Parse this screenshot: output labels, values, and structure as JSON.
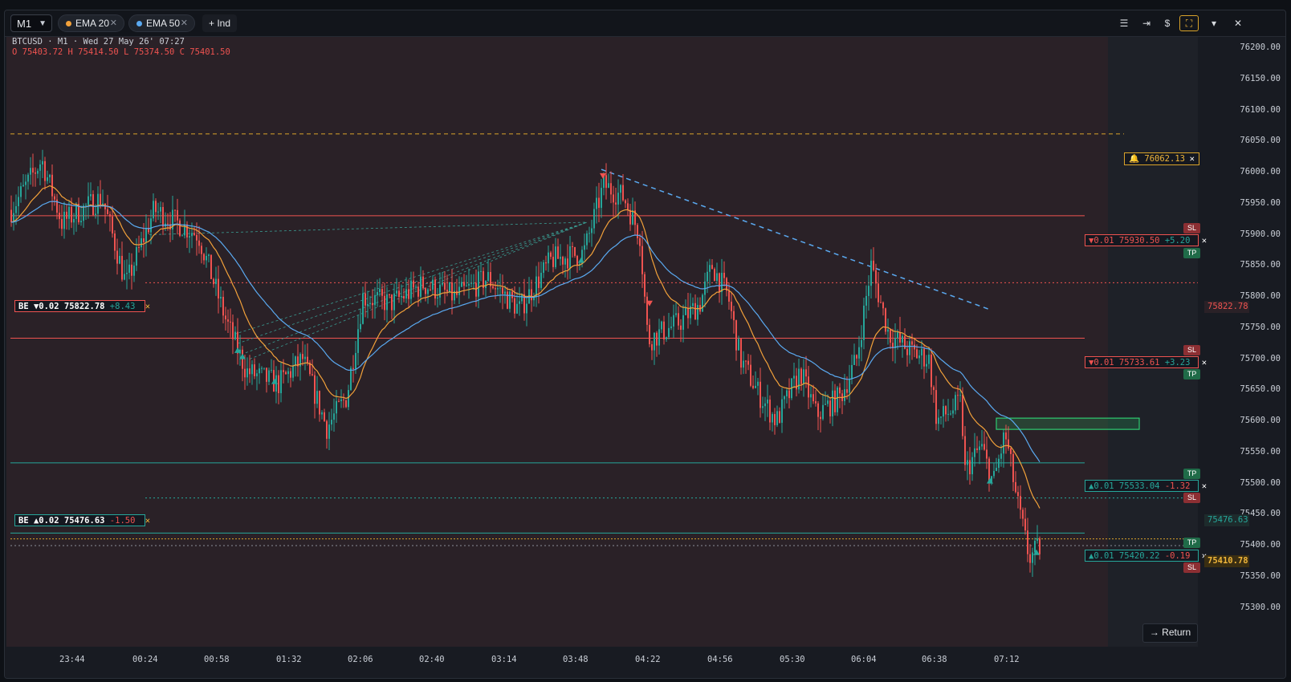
{
  "toolbar": {
    "timeframe": "M1",
    "indicators": [
      {
        "label": "EMA 20",
        "color": "#f2a13a"
      },
      {
        "label": "EMA 50",
        "color": "#5aa9f0"
      }
    ],
    "add_indicator_label": "+ Ind",
    "right_buttons": [
      "☰",
      "⇥",
      "$",
      "⛶",
      "▾",
      "✕"
    ]
  },
  "ohlc": {
    "header": "BTCUSD · M1 · Wed 27 May 26' 07:27",
    "values": "O 75403.72  H 75414.50  L 75374.50  C 75401.50"
  },
  "price_axis": [
    "76200.00",
    "76150.00",
    "76100.00",
    "76050.00",
    "76000.00",
    "75950.00",
    "75900.00",
    "75850.00",
    "75800.00",
    "75750.00",
    "75700.00",
    "75650.00",
    "75600.00",
    "75550.00",
    "75500.00",
    "75450.00",
    "75400.00",
    "75350.00",
    "75300.00"
  ],
  "time_axis": [
    "23:44",
    "00:24",
    "00:58",
    "01:32",
    "02:06",
    "02:40",
    "03:14",
    "03:48",
    "04:22",
    "04:56",
    "05:30",
    "06:04",
    "06:38",
    "07:12"
  ],
  "alert": {
    "label": "🔔 76062.13",
    "close": "✕"
  },
  "positions": [
    {
      "text": "▼0.01 75930.50",
      "pnl": "+5.20",
      "close": "✕",
      "side": "sell"
    },
    {
      "text": "▼0.01 75733.61",
      "pnl": "+3.23",
      "close": "✕",
      "side": "sell"
    },
    {
      "text": "▲0.01 75533.04",
      "pnl": "-1.32",
      "close": "✕",
      "side": "buy"
    },
    {
      "text": "▲0.01 75420.22",
      "pnl": "-0.19",
      "close": "✕",
      "side": "buy"
    }
  ],
  "breakeven": [
    {
      "text": "BE ▼0.02 75822.78",
      "pnl": "+8.43",
      "close": "✕"
    },
    {
      "text": "BE ▲0.02 75476.63",
      "pnl": "-1.50",
      "close": "✕"
    }
  ],
  "axis_tags": {
    "be_sell": "75822.78",
    "be_buy": "75476.63",
    "current": "75410.78"
  },
  "sl_label": "SL",
  "tp_label": "TP",
  "return_button": "→ Return",
  "colors": {
    "up": "#26a69a",
    "down": "#ef5350",
    "ema20": "#f2a13a",
    "ema50": "#5aa9f0",
    "alert": "#d9a32a"
  }
}
